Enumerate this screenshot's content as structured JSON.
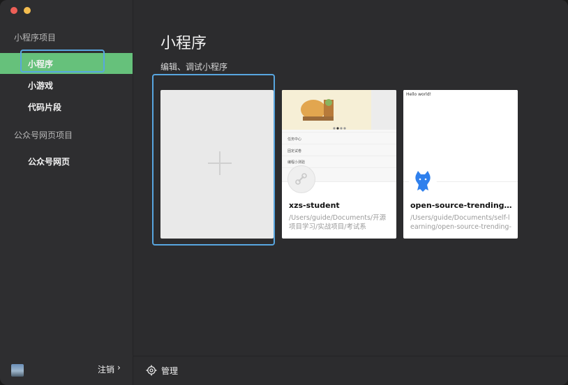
{
  "sidebar": {
    "section_mini": "小程序项目",
    "items": [
      {
        "label": "小程序"
      },
      {
        "label": "小游戏"
      },
      {
        "label": "代码片段"
      }
    ],
    "section_web": "公众号网页项目",
    "web_item": "公众号网页",
    "logout_label": "注销",
    "logout_chevron": "›"
  },
  "main": {
    "title": "小程序",
    "subtitle": "编辑、调试小程序",
    "projects": [
      {
        "name": "xzs-student",
        "path": "/Users/guide/Documents/开源项目学习/实战项目/考试系",
        "preview_rows": [
          "任务中心",
          "固定试卷",
          "编程小测验"
        ]
      },
      {
        "name": "open-source-trending-mi...",
        "path": "/Users/guide/Documents/self-learning/open-source-trending-",
        "preview_text": "Hello world!"
      }
    ]
  },
  "footer": {
    "manage_label": "管理"
  },
  "colors": {
    "accent_green": "#66c17b",
    "focus_blue": "#58a6e0",
    "window_bg": "#2c2c2e"
  }
}
